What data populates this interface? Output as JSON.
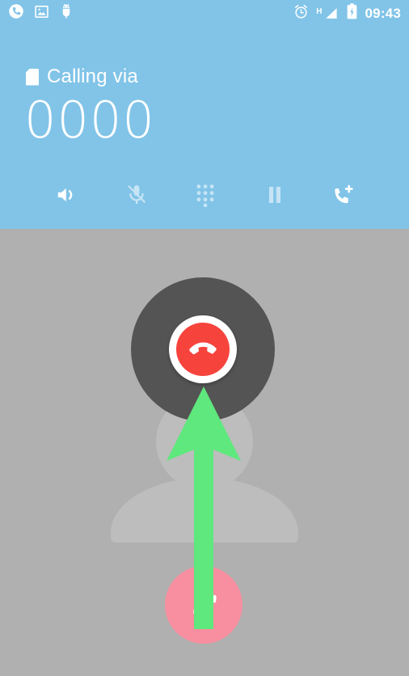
{
  "status_bar": {
    "time": "09:43",
    "network_type": "H",
    "left_icons": [
      {
        "name": "active-call-icon",
        "label": "ongoing call"
      },
      {
        "name": "screenshot-image-icon",
        "label": "screenshot saved"
      },
      {
        "name": "android-debug-icon",
        "label": "usb debugging"
      }
    ],
    "right_icons": [
      {
        "name": "alarm-clock-icon",
        "label": "alarm set"
      },
      {
        "name": "signal-bars-icon",
        "label": "mobile signal"
      },
      {
        "name": "battery-charging-icon",
        "label": "battery charging"
      }
    ]
  },
  "header": {
    "sim_label": "Calling via",
    "phone_number": "0000",
    "background_color": "#81c4e8",
    "text_color": "#ffffff"
  },
  "actions": [
    {
      "name": "speaker-button",
      "label": "Speaker",
      "icon": "speaker-icon",
      "state": "active"
    },
    {
      "name": "mute-button",
      "label": "Mute",
      "icon": "mic-off-icon",
      "state": "dim"
    },
    {
      "name": "dialpad-button",
      "label": "Dialpad",
      "icon": "dialpad-icon",
      "state": "dim"
    },
    {
      "name": "hold-button",
      "label": "Hold",
      "icon": "pause-icon",
      "state": "dim"
    },
    {
      "name": "add-call-button",
      "label": "Add call",
      "icon": "add-call-icon",
      "state": "active"
    }
  ],
  "call_body": {
    "background_color": "#b0b0b0",
    "avatar_color": "#bdbdbd",
    "ripple_color": "#545454",
    "end_call": {
      "label": "End call",
      "ring_color": "#ffffff",
      "button_color": "#f6443c",
      "icon": "end-call-handset-icon"
    },
    "answer": {
      "label": "Answer",
      "button_color": "#f78fa0",
      "icon": "handset-icon"
    },
    "gesture": {
      "name": "swipe-up-arrow",
      "label": "swipe up to end call",
      "color": "#5fe87d"
    }
  }
}
